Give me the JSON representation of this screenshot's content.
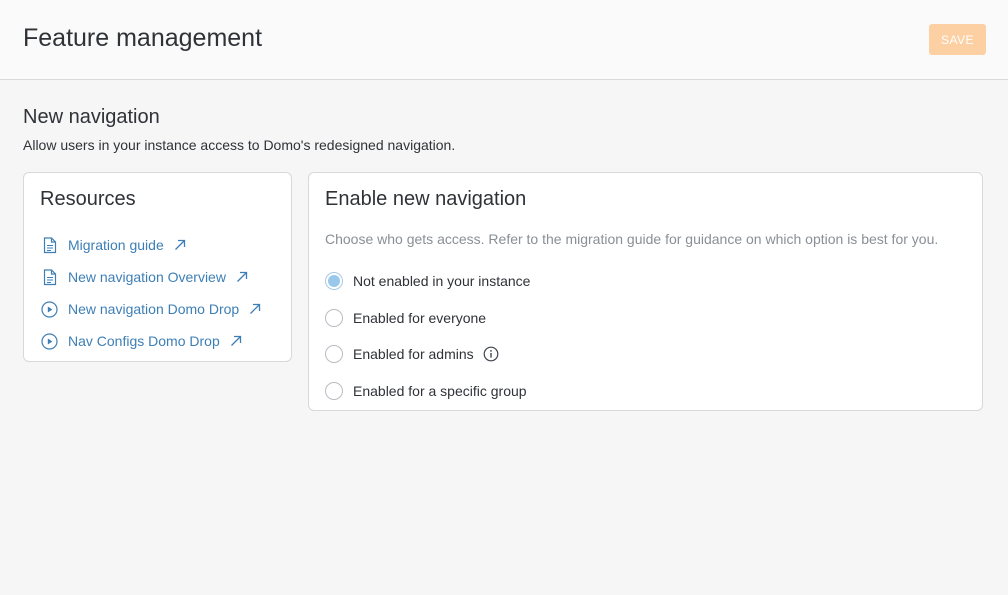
{
  "header": {
    "title": "Feature management",
    "save_label": "SAVE"
  },
  "section": {
    "title": "New navigation",
    "description": "Allow users in your instance access to Domo's redesigned navigation."
  },
  "resources": {
    "title": "Resources",
    "items": [
      {
        "label": "Migration guide",
        "icon": "document-icon"
      },
      {
        "label": "New navigation Overview",
        "icon": "document-icon"
      },
      {
        "label": "New navigation Domo Drop",
        "icon": "play-circle-icon"
      },
      {
        "label": "Nav Configs Domo Drop",
        "icon": "play-circle-icon"
      }
    ]
  },
  "enable": {
    "title": "Enable new navigation",
    "description": "Choose who gets access. Refer to the migration guide for guidance on which option is best for you.",
    "options": [
      {
        "label": "Not enabled in your instance",
        "selected": true
      },
      {
        "label": "Enabled for everyone",
        "selected": false
      },
      {
        "label": "Enabled for admins",
        "selected": false,
        "info": true
      },
      {
        "label": "Enabled for a specific group",
        "selected": false
      }
    ]
  },
  "colors": {
    "accent_link": "#3d7fb5",
    "save_disabled": "#fdd0a4",
    "radio_selected": "#99c8ea"
  }
}
